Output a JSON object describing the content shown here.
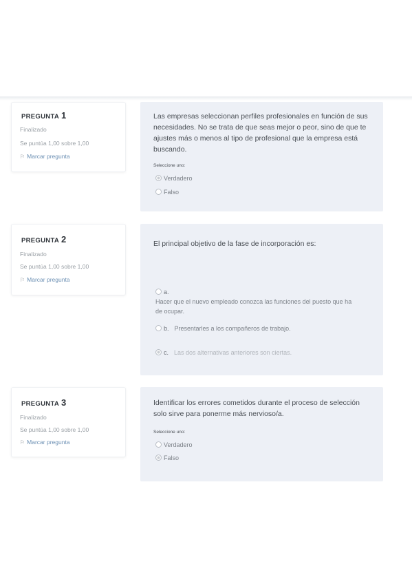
{
  "questions": [
    {
      "label": "PREGUNTA",
      "number": "1",
      "state": "Finalizado",
      "mark": "Se puntúa 1,00 sobre 1,00",
      "flag": "Marcar pregunta",
      "text": "Las empresas seleccionan perfiles profesionales en función de sus necesidades. No se trata de que seas mejor o peor, sino de que te ajustes más o menos al tipo de profesional que la empresa está buscando.",
      "prompt": "Seleccione uno:",
      "options": [
        {
          "letter": "",
          "text": "Verdadero",
          "checked": true
        },
        {
          "letter": "",
          "text": "Falso",
          "checked": false
        }
      ]
    },
    {
      "label": "PREGUNTA",
      "number": "2",
      "state": "Finalizado",
      "mark": "Se puntúa 1,00 sobre 1,00",
      "flag": "Marcar pregunta",
      "text": "El principal objetivo de la fase de incorporación es:",
      "prompt": "",
      "options": [
        {
          "letter": "a.",
          "text": "Hacer que el nuevo empleado conozca las funciones del puesto que ha de ocupar.",
          "checked": false
        },
        {
          "letter": "b.",
          "text": "Presentarles a los compañeros de trabajo.",
          "checked": false
        },
        {
          "letter": "c.",
          "text": "Las dos alternativas anteriores son ciertas.",
          "checked": true
        }
      ]
    },
    {
      "label": "PREGUNTA",
      "number": "3",
      "state": "Finalizado",
      "mark": "Se puntúa 1,00 sobre 1,00",
      "flag": "Marcar pregunta",
      "text": "Identificar los errores cometidos durante el proceso de selección solo sirve para ponerme más nervioso/a.",
      "prompt": "Seleccione uno:",
      "options": [
        {
          "letter": "",
          "text": "Verdadero",
          "checked": false
        },
        {
          "letter": "",
          "text": "Falso",
          "checked": true
        }
      ]
    }
  ]
}
